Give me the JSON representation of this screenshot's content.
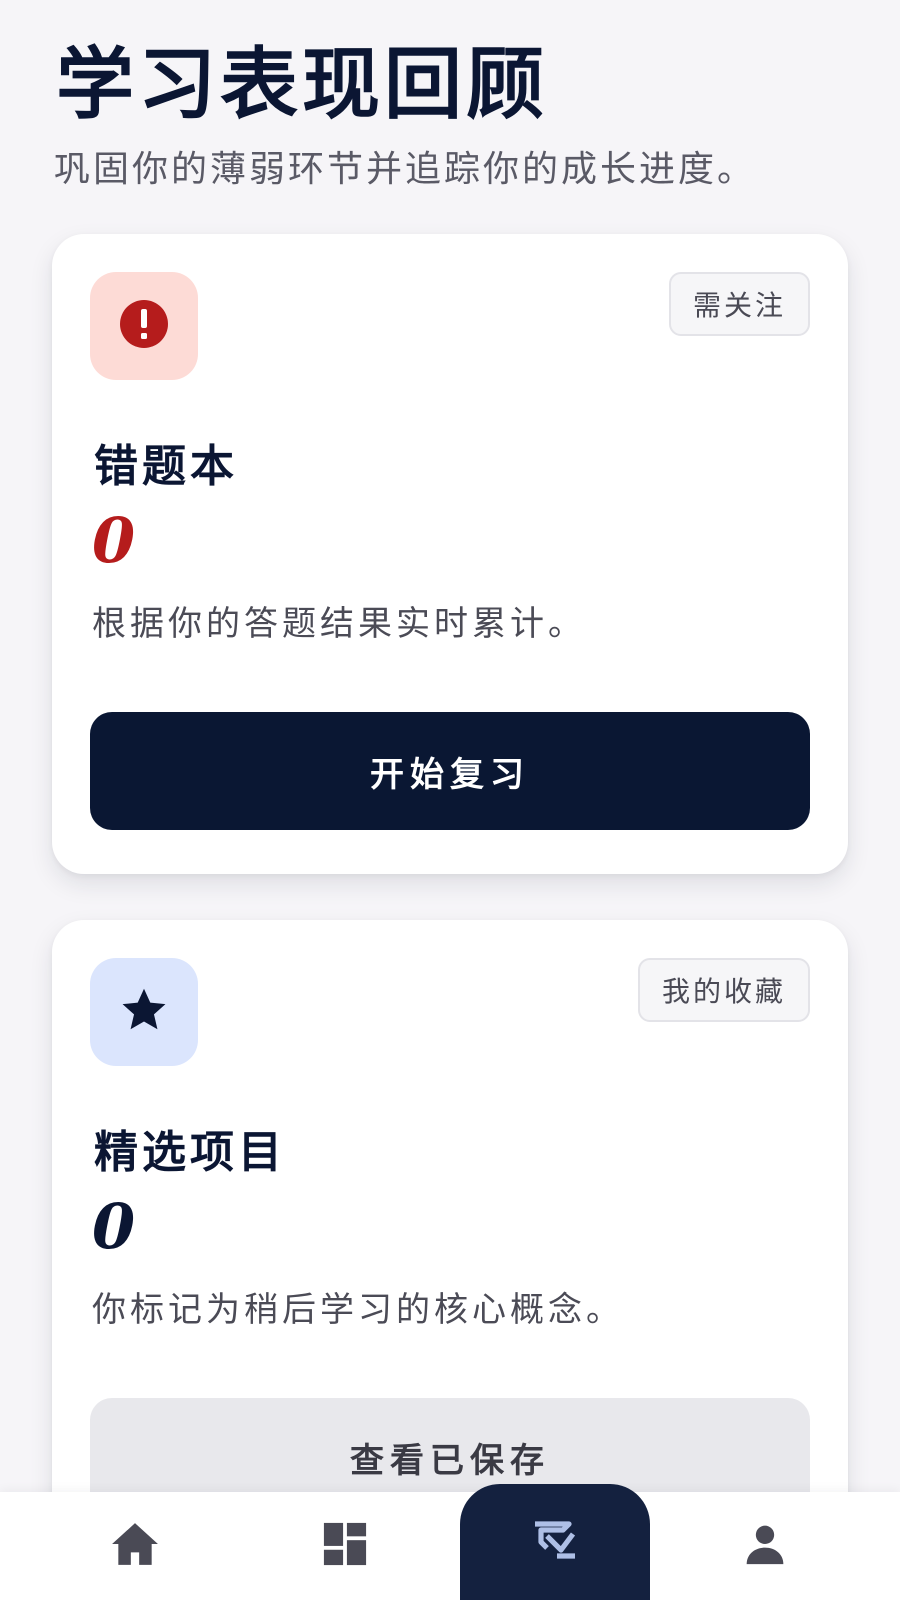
{
  "header": {
    "title": "学习表现回顾",
    "subtitle": "巩固你的薄弱环节并追踪你的成长进度。"
  },
  "cards": [
    {
      "icon": "alert-circle-icon",
      "tag": "需关注",
      "title": "错题本",
      "count": "0",
      "description": "根据你的答题结果实时累计。",
      "button_label": "开始复习"
    },
    {
      "icon": "star-icon",
      "tag": "我的收藏",
      "title": "精选项目",
      "count": "0",
      "description": "你标记为稍后学习的核心概念。",
      "button_label": "查看已保存"
    }
  ],
  "bottom_nav": {
    "items": [
      {
        "icon": "home-icon",
        "active": false
      },
      {
        "icon": "dashboard-icon",
        "active": false
      },
      {
        "icon": "review-icon",
        "active": true
      },
      {
        "icon": "profile-icon",
        "active": false
      }
    ]
  },
  "colors": {
    "navy": "#0a1733",
    "alert_red": "#b51c1c",
    "alert_bg": "#fddbd6",
    "star_bg": "#dbe5fd",
    "background": "#f6f5f8"
  }
}
